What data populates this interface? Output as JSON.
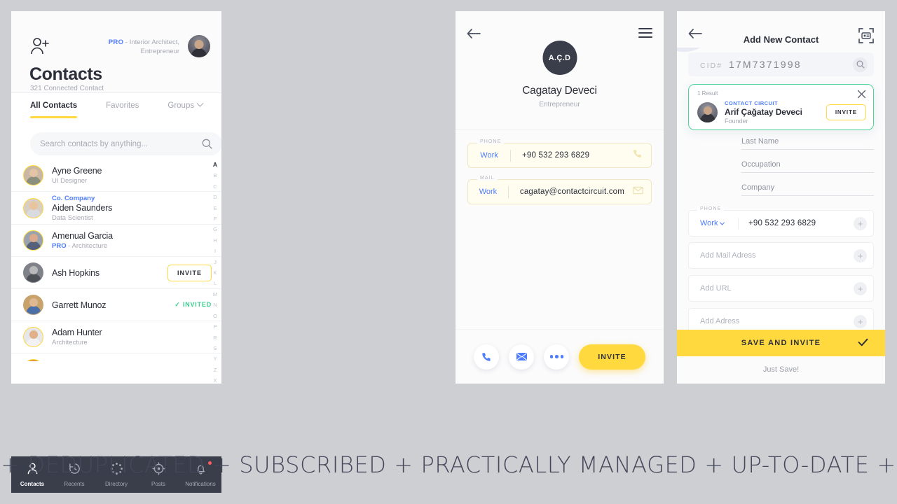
{
  "contacts_panel": {
    "header": {
      "add_user_icon": "add-user-icon",
      "role_pro": "PRO",
      "role_text": "- Interior Architect, Entrepreneur",
      "avatar": "user-avatar"
    },
    "title": "Contacts",
    "subtitle": "321 Connected Contact",
    "tabs": [
      {
        "label": "All Contacts",
        "active": true
      },
      {
        "label": "Favorites",
        "active": false
      },
      {
        "label": "Groups",
        "active": false,
        "has_chevron": true
      }
    ],
    "search": {
      "placeholder": "Search contacts by anything...",
      "icon": "search-icon"
    },
    "rows": [
      {
        "name": "Ayne Greene",
        "sub": "UI Designer",
        "company": "",
        "action": ""
      },
      {
        "name": "Aiden Saunders",
        "sub": "Data Scientist",
        "company": "Co. Company",
        "action": ""
      },
      {
        "name": "Amenual Garcia",
        "sub": "- Architecture",
        "pro": "PRO",
        "company": "",
        "action": ""
      },
      {
        "name": "Ash Hopkins",
        "sub": "",
        "company": "",
        "action": "INVITE"
      },
      {
        "name": "Garrett Munoz",
        "sub": "",
        "company": "",
        "action": "INVITED"
      },
      {
        "name": "Adam Hunter",
        "sub": "Architecture",
        "company": "",
        "action": ""
      }
    ],
    "alphabet": [
      "A",
      "B",
      "C",
      "D",
      "E",
      "F",
      "G",
      "H",
      "I",
      "J",
      "K",
      "L",
      "M",
      "N",
      "O",
      "P",
      "R",
      "S",
      "Y",
      "Z",
      "X"
    ],
    "tabbar": [
      {
        "label": "Contacts",
        "icon": "person-icon",
        "active": true,
        "badge": false
      },
      {
        "label": "Recents",
        "icon": "history-icon",
        "active": false,
        "badge": false
      },
      {
        "label": "Directory",
        "icon": "directory-icon",
        "active": false,
        "badge": false
      },
      {
        "label": "Posts",
        "icon": "target-icon",
        "active": false,
        "badge": false
      },
      {
        "label": "Notifications",
        "icon": "bell-icon",
        "active": false,
        "badge": true
      }
    ]
  },
  "detail_panel": {
    "back_icon": "back-arrow-icon",
    "menu_icon": "hamburger-icon",
    "initials": "A.Ç.D",
    "name": "Cagatay Deveci",
    "occupation": "Entrepreneur",
    "fields": [
      {
        "caption": "PHONE",
        "kind": "Work",
        "value": "+90 532 293 6829",
        "icon": "phone-icon"
      },
      {
        "caption": "MAIL",
        "kind": "Work",
        "value": "cagatay@contactcircuit.com",
        "icon": "mail-icon"
      }
    ],
    "actions": {
      "call_icon": "phone-icon",
      "mail_icon": "mail-icon",
      "more_icon": "more-dots-icon",
      "invite_label": "INVITE"
    }
  },
  "add_panel": {
    "back_icon": "back-arrow-icon",
    "title": "Add New Contact",
    "scan_icon": "scan-card-icon",
    "cid": {
      "prefix": "CID#",
      "value": "17M7371998",
      "search_icon": "search-icon"
    },
    "result": {
      "count_label": "1 Result",
      "close_icon": "close-icon",
      "company": "CONTACT CIRCUIT",
      "name": "Arif Çağatay Deveci",
      "role": "Founder",
      "invite_label": "INVITE"
    },
    "text_fields": [
      {
        "placeholder": "Last Name"
      },
      {
        "placeholder": "Occupation"
      },
      {
        "placeholder": "Company"
      }
    ],
    "phone_row": {
      "caption": "PHONE",
      "kind": "Work",
      "value": "+90 532 293 6829",
      "add_icon": "plus-icon"
    },
    "add_rows": [
      {
        "placeholder": "Add Mail Adress",
        "add_icon": "plus-icon"
      },
      {
        "placeholder": "Add URL",
        "add_icon": "plus-icon"
      },
      {
        "placeholder": "Add Adress",
        "add_icon": "plus-icon"
      }
    ],
    "save_label": "SAVE AND INVITE",
    "save_check_icon": "check-icon",
    "just_save_label": "Just Save!"
  },
  "banner": {
    "text": "+ DEDUPLICATED + SUBSCRIBED + PRACTICALLY MANAGED + UP-TO-DATE +"
  },
  "colors": {
    "yellow": "#ffd93d",
    "blue": "#4d7cfe",
    "green": "#3ccf8e",
    "dark": "#3a3d4a",
    "muted": "#a7a9b4"
  }
}
